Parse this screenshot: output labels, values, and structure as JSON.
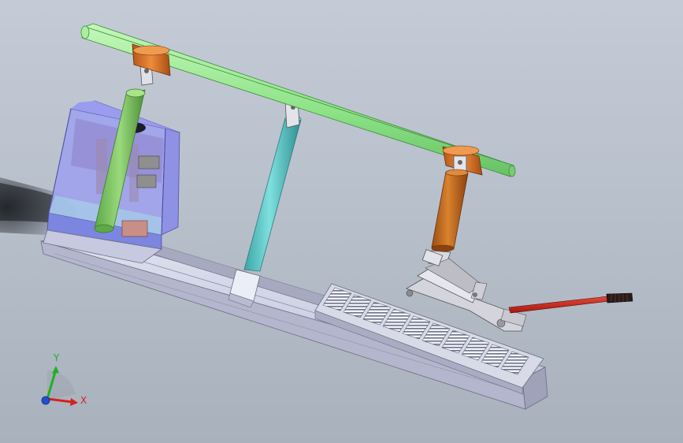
{
  "viewport": {
    "background_top": "#c4cbd6",
    "background_bottom": "#a9b1bd"
  },
  "model": {
    "parts": [
      {
        "name": "main-beam",
        "color": "#98e894"
      },
      {
        "name": "beam-collar-left",
        "color": "#d2691e"
      },
      {
        "name": "beam-collar-right",
        "color": "#d2691e"
      },
      {
        "name": "left-cylinder-rod",
        "color": "#8fd06e"
      },
      {
        "name": "center-support-post",
        "color": "#5bc7c4"
      },
      {
        "name": "right-hydraulic-cylinder",
        "color": "#c46a1e"
      },
      {
        "name": "left-housing",
        "color": "#8f94f0"
      },
      {
        "name": "base-rail",
        "color": "#c6c9e0"
      },
      {
        "name": "perforated-platform",
        "color": "#b5b8ce"
      },
      {
        "name": "floor-jack",
        "color": "#c8c8d0"
      },
      {
        "name": "jack-handle",
        "color": "#c42a1e"
      }
    ]
  },
  "triad": {
    "x_label": "X",
    "y_label": "Y",
    "x_color": "#d62020",
    "y_color": "#20b020",
    "z_color": "#2050d0"
  }
}
